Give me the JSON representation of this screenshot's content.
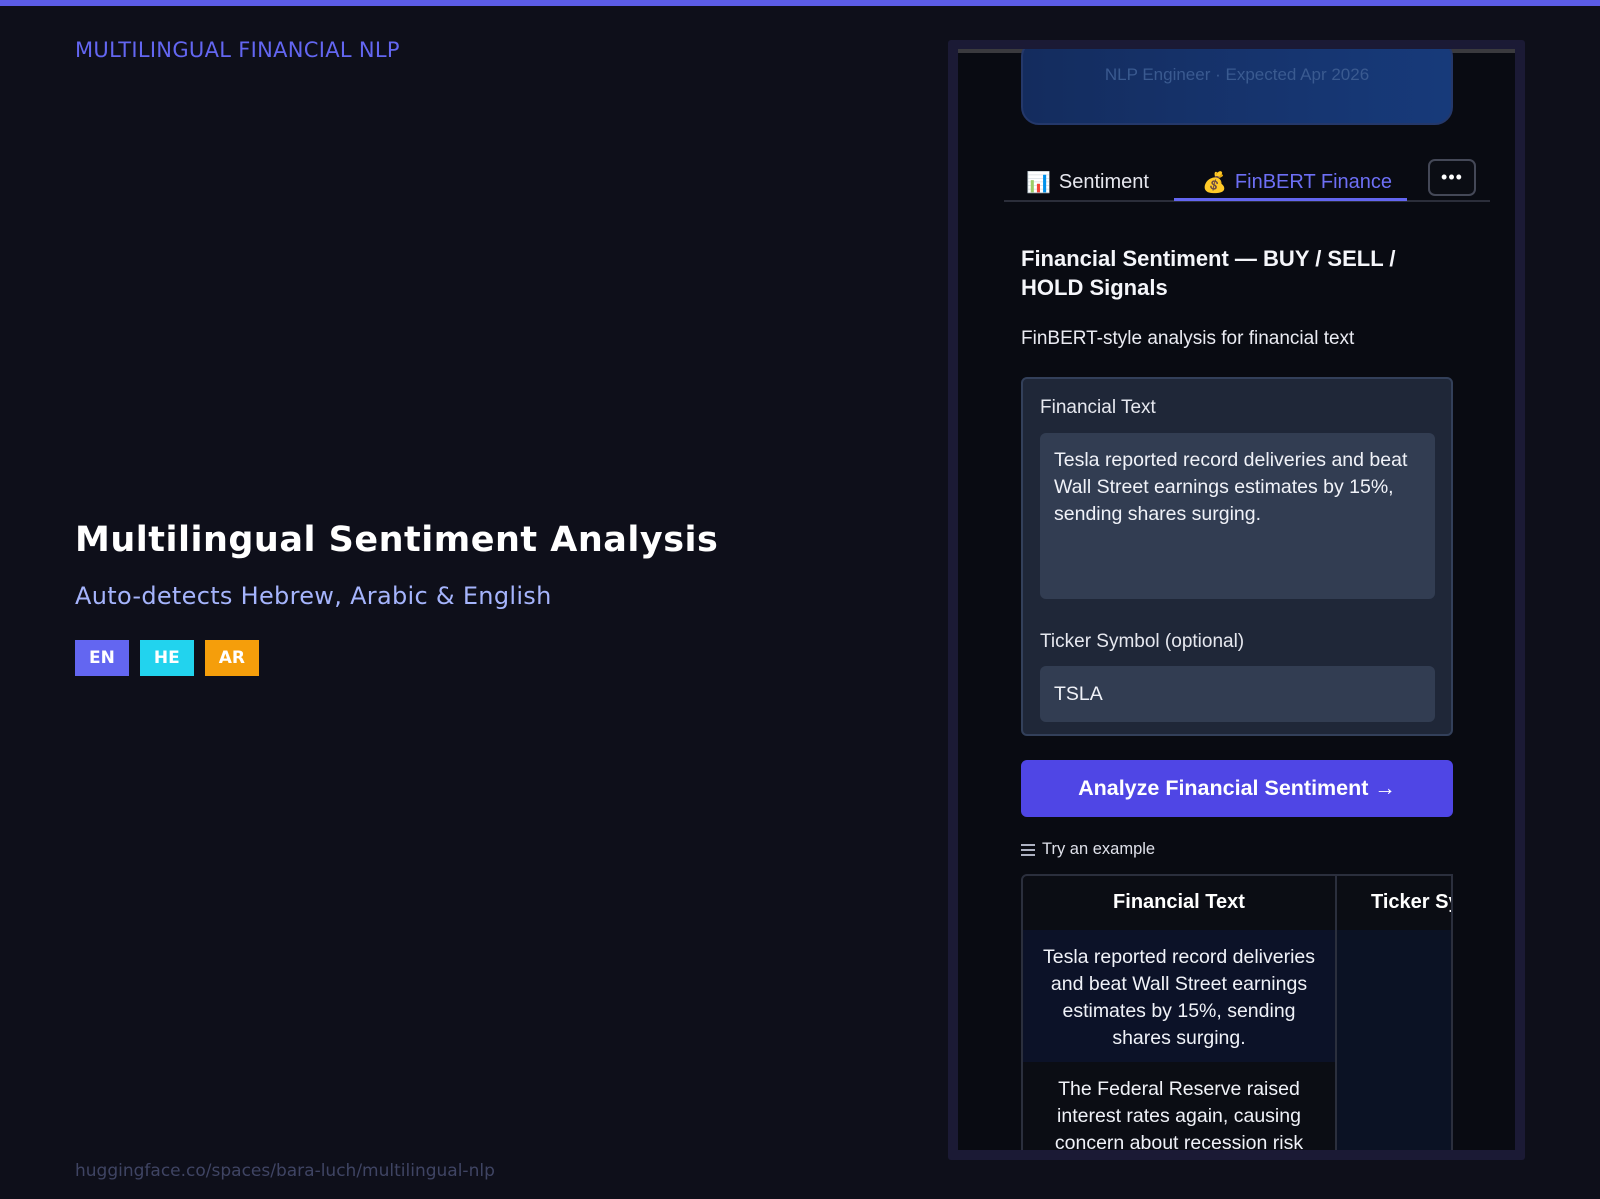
{
  "brand": "MULTILINGUAL FINANCIAL NLP",
  "hero": {
    "title": "Multilingual Sentiment Analysis",
    "subtitle": "Auto-detects Hebrew, Arabic & English",
    "badges": [
      {
        "label": "EN",
        "color": "#6366f1"
      },
      {
        "label": "HE",
        "color": "#22d3ee"
      },
      {
        "label": "AR",
        "color": "#f59e0b"
      }
    ]
  },
  "footer_url": "huggingface.co/spaces/bara-luch/multilingual-nlp",
  "phone": {
    "profile_subtitle": "NLP Engineer · Expected Apr 2026",
    "tabs": [
      {
        "label": "Sentiment",
        "icon": "bar-chart-icon",
        "glyph": "📊"
      },
      {
        "label": "FinBERT Finance",
        "icon": "money-bag-icon",
        "glyph": "💰",
        "active": true
      }
    ],
    "more_label": "•••",
    "section_title": "Financial Sentiment — BUY / SELL / HOLD Signals",
    "section_desc": "FinBERT-style analysis for financial text",
    "form": {
      "text_label": "Financial Text",
      "text_value": "Tesla reported record deliveries and beat Wall Street earnings estimates by 15%, sending shares surging.",
      "ticker_label": "Ticker Symbol (optional)",
      "ticker_value": "TSLA"
    },
    "analyze_button": "Analyze Financial Sentiment →",
    "examples": {
      "heading": "Try an example",
      "headers": [
        "Financial Text",
        "Ticker Sy"
      ],
      "rows": [
        {
          "text": "Tesla reported record deliveries and beat Wall Street earnings estimates by 15%, sending shares surging.",
          "ticker": ""
        },
        {
          "text": "The Federal Reserve raised interest rates again, causing concern about recession risk",
          "ticker": ""
        }
      ]
    }
  },
  "colors": {
    "accent": "#6366f1",
    "button": "#4f46e5",
    "background": "#0e0f1a"
  }
}
